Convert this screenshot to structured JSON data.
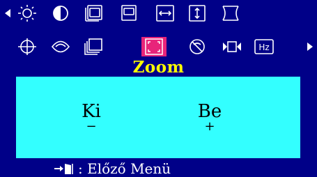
{
  "osd_menu": {
    "left_arrow_icon": "triangle-left-icon",
    "right_arrow_icon": "triangle-right-icon",
    "icons_row1": [
      "brightness-icon",
      "contrast-icon",
      "h-position-icon",
      "v-position-icon",
      "h-size-icon",
      "v-size-icon",
      "pincushion-icon"
    ],
    "icons_row2": [
      "geometry-icon",
      "degauss-icon",
      "trapezoid-icon",
      "zoom-icon",
      "moire-icon",
      "video-input-icon",
      "refresh-rate-icon"
    ],
    "selected_icon": "zoom-icon"
  },
  "title": "Zoom",
  "options": {
    "left": {
      "label": "Ki",
      "sign": "−"
    },
    "right": {
      "label": "Be",
      "sign": "+"
    }
  },
  "footer": {
    "icon": "exit-door-icon",
    "text": ": Előző Menü"
  },
  "colors": {
    "background": "#000088",
    "panel": "#33ffff",
    "title": "#ffff00",
    "highlight": "#e8247a"
  }
}
